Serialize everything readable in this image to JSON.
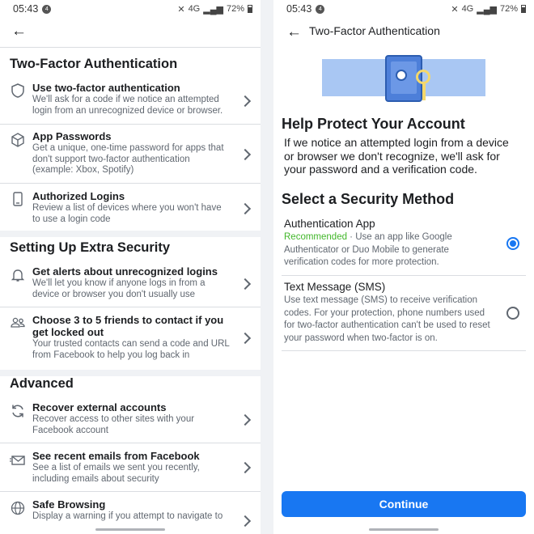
{
  "status_bar": {
    "time": "05:43",
    "notification_count": "4",
    "signal_text": "4G",
    "battery": "72%"
  },
  "left": {
    "sections": [
      {
        "title": "Two-Factor Authentication",
        "items": [
          {
            "icon": "shield-icon",
            "title": "Use two-factor authentication",
            "desc": "We'll ask for a code if we notice an attempted login from an unrecognized device or browser."
          },
          {
            "icon": "cube-icon",
            "title": "App Passwords",
            "desc": "Get a unique, one-time password for apps that don't support two-factor authentication (example: Xbox, Spotify)"
          },
          {
            "icon": "phone-icon",
            "title": "Authorized Logins",
            "desc": "Review a list of devices where you won't have to use a login code"
          }
        ]
      },
      {
        "title": "Setting Up Extra Security",
        "items": [
          {
            "icon": "bell-icon",
            "title": "Get alerts about unrecognized logins",
            "desc": "We'll let you know if anyone logs in from a device or browser you don't usually use"
          },
          {
            "icon": "people-icon",
            "title": "Choose 3 to 5 friends to contact if you get locked out",
            "desc": "Your trusted contacts can send a code and URL from Facebook to help you log back in"
          }
        ]
      },
      {
        "title": "Advanced",
        "items": [
          {
            "icon": "refresh-icon",
            "title": "Recover external accounts",
            "desc": "Recover access to other sites with your Facebook account"
          },
          {
            "icon": "mail-icon",
            "title": "See recent emails from Facebook",
            "desc": "See a list of emails we sent you recently, including emails about security"
          },
          {
            "icon": "globe-icon",
            "title": "Safe Browsing",
            "desc": "Display a warning if you attempt to navigate to"
          }
        ]
      }
    ]
  },
  "right": {
    "page_title": "Two-Factor Authentication",
    "headline": "Help Protect Your Account",
    "intro": "If we notice an attempted login from a device or browser we don't recognize, we'll ask for your password and a verification code.",
    "method_title": "Select a Security Method",
    "options": [
      {
        "title": "Authentication App",
        "recommended": "Recommended",
        "desc": " · Use an app like Google Authenticator or Duo Mobile to generate verification codes for more protection.",
        "selected": true
      },
      {
        "title": "Text Message (SMS)",
        "recommended": "",
        "desc": "Use text message (SMS) to receive verification codes. For your protection, phone numbers used for two-factor authentication can't be used to reset your password when two-factor is on.",
        "selected": false
      }
    ],
    "continue_label": "Continue"
  },
  "colors": {
    "accent": "#1877f2",
    "recommended": "#42b72a",
    "secondary_text": "#606770"
  }
}
